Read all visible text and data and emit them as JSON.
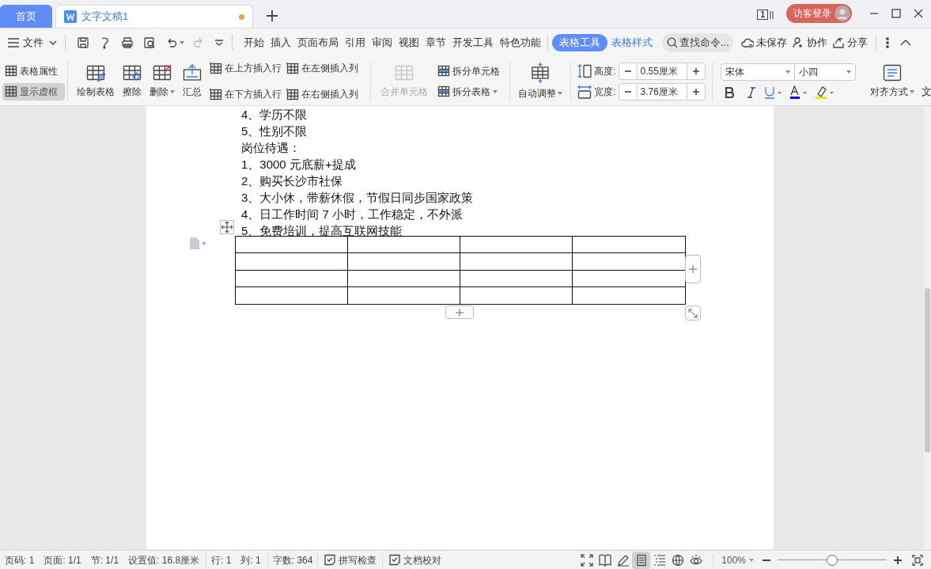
{
  "tabs": [
    {
      "kind": "home",
      "label": "首页",
      "selected": false
    },
    {
      "kind": "doc",
      "label": "文字文稿1",
      "selected": true,
      "unsaved": true
    }
  ],
  "title_bar": {
    "page_badge": "1",
    "login": "访客登录"
  },
  "menu": {
    "file": "文件",
    "tabs": [
      {
        "label": "开始",
        "selected": false,
        "kind": "plain"
      },
      {
        "label": "插入",
        "selected": false,
        "kind": "plain"
      },
      {
        "label": "页面布局",
        "selected": false,
        "kind": "plain"
      },
      {
        "label": "引用",
        "selected": false,
        "kind": "plain"
      },
      {
        "label": "审阅",
        "selected": false,
        "kind": "plain"
      },
      {
        "label": "视图",
        "selected": false,
        "kind": "plain"
      },
      {
        "label": "章节",
        "selected": false,
        "kind": "plain"
      },
      {
        "label": "开发工具",
        "selected": false,
        "kind": "plain"
      },
      {
        "label": "特色功能",
        "selected": false,
        "kind": "plain"
      },
      {
        "label": "表格工具",
        "selected": true,
        "kind": "context"
      },
      {
        "label": "表格样式",
        "selected": false,
        "kind": "context"
      }
    ],
    "search": {
      "placeholder": "查找命令..."
    },
    "actions": [
      {
        "kind": "cloud",
        "label": "未保存"
      },
      {
        "kind": "people",
        "label": "协作"
      },
      {
        "kind": "share",
        "label": "分享"
      }
    ]
  },
  "ribbon": {
    "toggles": [
      {
        "label": "表格属性",
        "on": false
      },
      {
        "label": "显示虚框",
        "on": true
      }
    ],
    "large": [
      {
        "label": "绘制表格",
        "dropdown": false
      },
      {
        "label": "擦除",
        "dropdown": false
      },
      {
        "label": "删除",
        "dropdown": true
      },
      {
        "label": "汇总",
        "dropdown": false
      }
    ],
    "insert": [
      {
        "label": "在上方插入行"
      },
      {
        "label": "在下方插入行"
      },
      {
        "label": "在左侧插入列"
      },
      {
        "label": "在右侧插入列"
      }
    ],
    "merge": {
      "label": "合并单元格",
      "disabled": true
    },
    "split": [
      {
        "label": "拆分单元格",
        "dropdown": false
      },
      {
        "label": "拆分表格",
        "dropdown": true
      }
    ],
    "autofit": {
      "label": "自动调整"
    },
    "size_fields": [
      {
        "label": "高度:",
        "value": "0.55厘米"
      },
      {
        "label": "宽度:",
        "value": "3.76厘米"
      }
    ],
    "font": {
      "family": "宋体",
      "size": "小四"
    },
    "align": {
      "label": "对齐方式"
    },
    "cut_label": "文"
  },
  "document": {
    "lines": [
      "4、学历不限",
      "5、性别不限",
      "岗位待遇：",
      "1、3000 元底薪+提成",
      "2、购买长沙市社保",
      "3、大小休，带薪休假，节假日同步国家政策",
      "4、日工作时间 7 小时，工作稳定，不外派",
      "5、免费培训，提高互联网技能"
    ]
  },
  "status_bar": {
    "items": [
      "页码: 1",
      "页面: 1/1",
      "节: 1/1",
      "设置值: 16.8厘米",
      "行: 1",
      "列: 1",
      "字数: 364"
    ],
    "checks": [
      "拼写检查",
      "文档校对"
    ],
    "views": [
      {
        "kind": "fullscreen",
        "selected": false
      },
      {
        "kind": "read",
        "selected": false
      },
      {
        "kind": "edit",
        "selected": false
      },
      {
        "kind": "page",
        "selected": true
      },
      {
        "kind": "outline",
        "selected": false
      },
      {
        "kind": "web",
        "selected": false
      },
      {
        "kind": "eye",
        "selected": false
      }
    ],
    "zoom": {
      "value": "100%",
      "level": 0.5
    }
  }
}
